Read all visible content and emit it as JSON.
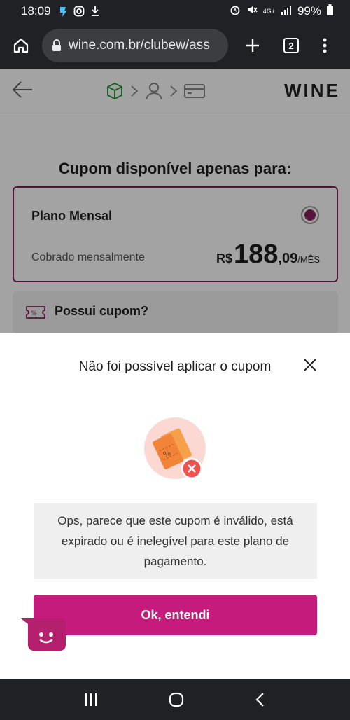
{
  "status_bar": {
    "time": "18:09",
    "network": "4G+",
    "battery": "99%"
  },
  "browser": {
    "url": "wine.com.br/clubew/ass",
    "tab_count": "2"
  },
  "header": {
    "logo": "WINE",
    "steps": [
      "box-icon",
      "user-icon",
      "card-icon"
    ]
  },
  "offer": {
    "title": "Cupom disponível apenas para:",
    "plan_name": "Plano Mensal",
    "billing": "Cobrado mensalmente",
    "price_currency": "R$",
    "price_int": "188",
    "price_dec": ",09",
    "price_period": "/MÊS"
  },
  "coupon": {
    "label": "Possui cupom?"
  },
  "modal": {
    "title": "Não foi possível aplicar o cupom",
    "message": "Ops, parece que este cupom é inválido, está expirado ou é inelegível para este plano de pagamento.",
    "ok_label": "Ok, entendi"
  },
  "colors": {
    "brand": "#c41b7c",
    "plan_border": "#8a1f5c",
    "error": "#ef5350",
    "ticket": "#f2994a"
  }
}
